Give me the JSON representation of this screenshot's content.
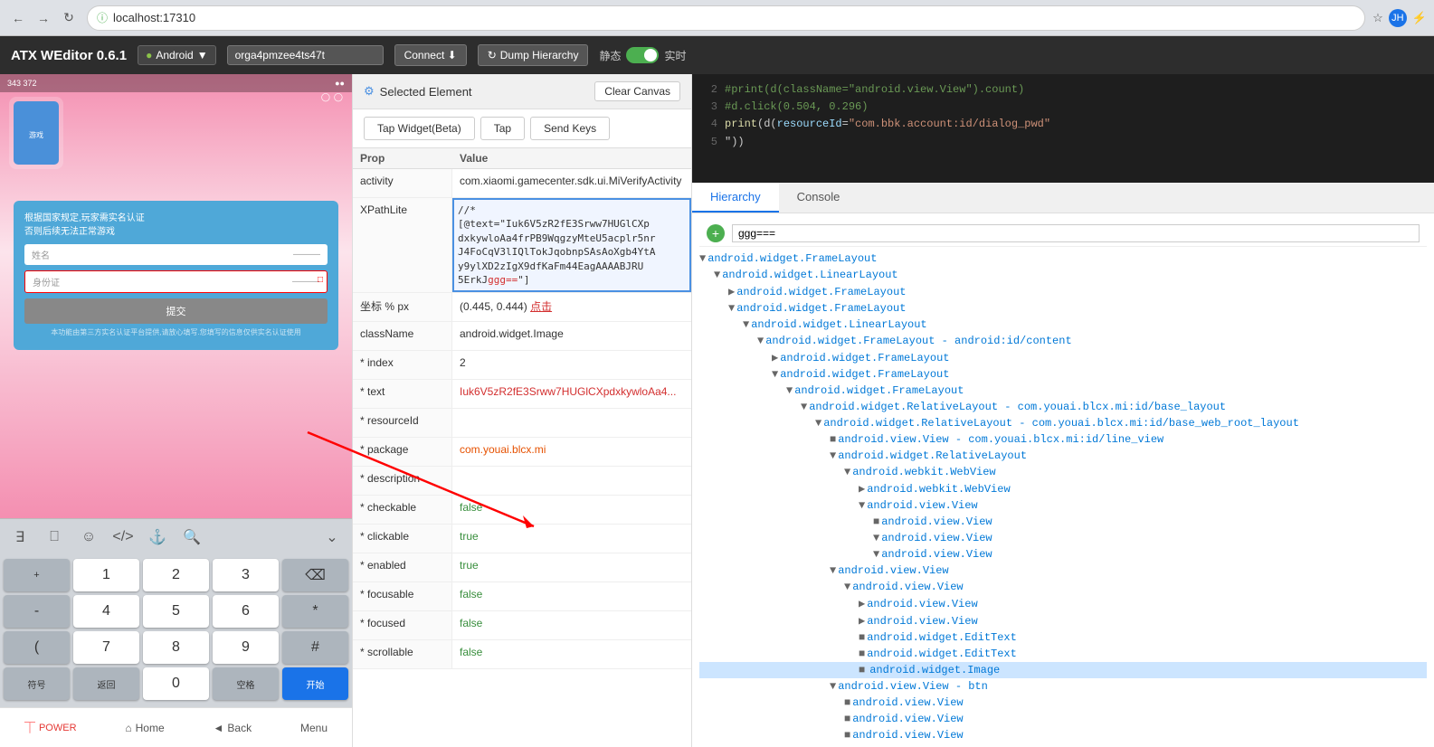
{
  "browser": {
    "url": "localhost:17310",
    "back_label": "←",
    "forward_label": "→",
    "refresh_label": "↻"
  },
  "app_header": {
    "title": "ATX WEditor 0.6.1",
    "android_label": "Android",
    "device_id": "orga4pmzee4ts47t",
    "connect_label": "Connect ⬇",
    "dump_label": "Dump Hierarchy",
    "static_label": "静态",
    "realtime_label": "实时"
  },
  "props_panel": {
    "selected_element_label": "Selected Element",
    "clear_canvas_label": "Clear Canvas",
    "tap_widget_label": "Tap Widget(Beta)",
    "tap_label": "Tap",
    "send_keys_label": "Send Keys",
    "header_prop": "Prop",
    "header_value": "Value",
    "rows": [
      {
        "name": "activity",
        "value": "com.xiaomi.gamecenter.sdk.ui.MiVerifyActivity",
        "style": "normal"
      },
      {
        "name": "XPathLite",
        "value": "//*[@text=\"Iuk6V5zR2fE3Srww7HUGlCXpdxkywloAa4frPB9WqgzyMteU5acplr5nrJ4FoCqV3lIQlTokJqobnpSAsAoXgb4YtAy9ylXD2zIgX9dfKaFm44EagAAAABJRU5ErkJggg==\"]",
        "style": "editable"
      },
      {
        "name": "坐标 % px",
        "value": "(0.445, 0.444) 点击",
        "style": "normal"
      },
      {
        "name": "className",
        "value": "android.widget.Image",
        "style": "normal"
      },
      {
        "name": "* index",
        "value": "2",
        "style": "normal"
      },
      {
        "name": "* text",
        "value": "Iuk6V5zR2fE3Srww7HUGlCXpdxkywloAa4...",
        "style": "red"
      },
      {
        "name": "* resourceId",
        "value": "",
        "style": "normal"
      },
      {
        "name": "* package",
        "value": "com.youai.blcx.mi",
        "style": "orange"
      },
      {
        "name": "* description",
        "value": "",
        "style": "normal"
      },
      {
        "name": "* checkable",
        "value": "false",
        "style": "green"
      },
      {
        "name": "* clickable",
        "value": "true",
        "style": "green"
      },
      {
        "name": "* enabled",
        "value": "true",
        "style": "green"
      },
      {
        "name": "* focusable",
        "value": "false",
        "style": "green"
      },
      {
        "name": "* focused",
        "value": "false",
        "style": "green"
      },
      {
        "name": "* scrollable",
        "value": "false",
        "style": "green"
      }
    ]
  },
  "code_panel": {
    "lines": [
      {
        "num": "2",
        "text": "#print(d(className=\"android.view.View\").count)"
      },
      {
        "num": "3",
        "text": "#d.click(0.504, 0.296)"
      },
      {
        "num": "4",
        "text": "print(d(resourceId=\"com.bbk.account:id/dialog_pwd\""
      },
      {
        "num": "5",
        "text": "\"))"
      }
    ]
  },
  "tabs": {
    "hierarchy_label": "Hierarchy",
    "console_label": "Console",
    "active": "hierarchy"
  },
  "hierarchy": {
    "search_placeholder": "ggg===",
    "nodes": [
      {
        "indent": 0,
        "text": "android.widget.FrameLayout"
      },
      {
        "indent": 1,
        "text": "android.widget.LinearLayout"
      },
      {
        "indent": 2,
        "text": "android.widget.FrameLayout"
      },
      {
        "indent": 2,
        "text": "android.widget.FrameLayout"
      },
      {
        "indent": 3,
        "text": "android.widget.LinearLayout"
      },
      {
        "indent": 4,
        "text": "android.widget.FrameLayout - android:id/content"
      },
      {
        "indent": 5,
        "text": "android.widget.FrameLayout"
      },
      {
        "indent": 5,
        "text": "android.widget.FrameLayout"
      },
      {
        "indent": 6,
        "text": "android.widget.FrameLayout"
      },
      {
        "indent": 7,
        "text": "android.widget.RelativeLayout - com.youai.blcx.mi:id/base_layout"
      },
      {
        "indent": 8,
        "text": "android.widget.RelativeLayout - com.youai.blcx.mi:id/base_web_root_layout"
      },
      {
        "indent": 9,
        "text": "android.view.View - com.youai.blcx.mi:id/line_view"
      },
      {
        "indent": 9,
        "text": "android.widget.RelativeLayout"
      },
      {
        "indent": 10,
        "text": "android.webkit.WebView"
      },
      {
        "indent": 11,
        "text": "android.webkit.WebView"
      },
      {
        "indent": 11,
        "text": "android.view.View"
      },
      {
        "indent": 12,
        "text": "android.view.View"
      },
      {
        "indent": 12,
        "text": "android.view.View"
      },
      {
        "indent": 12,
        "text": "android.view.View"
      },
      {
        "indent": 9,
        "text": "android.view.View"
      },
      {
        "indent": 10,
        "text": "android.view.View"
      },
      {
        "indent": 11,
        "text": "android.view.View"
      },
      {
        "indent": 11,
        "text": "android.view.View"
      },
      {
        "indent": 11,
        "text": "android.widget.EditText"
      },
      {
        "indent": 11,
        "text": "android.widget.EditText"
      },
      {
        "indent": 11,
        "text": "android.widget.Image",
        "selected": true
      },
      {
        "indent": 9,
        "text": "android.view.View - btn"
      },
      {
        "indent": 10,
        "text": "android.view.View"
      },
      {
        "indent": 10,
        "text": "android.view.View"
      },
      {
        "indent": 10,
        "text": "android.view.View"
      }
    ]
  },
  "phone": {
    "dialog_title": "根据国家规定,玩家需实名认证\n否则后续无法正常游戏",
    "field1_placeholder": "姓名",
    "field2_placeholder": "身份证",
    "submit_label": "提交",
    "bottom_notice": "本功能由第三方实名认证平台提供,请放心填写.您填写的信息仅供实名认证使用",
    "keyboard_keys": {
      "row1": [
        "+",
        "1",
        "2",
        "3",
        "⌫"
      ],
      "row2": [
        "-",
        "4",
        "5",
        "6",
        "*"
      ],
      "row3": [
        "(",
        "7",
        "8",
        "9",
        "#"
      ],
      "row4": [
        "符号",
        "返回",
        "0",
        "空格",
        "开始"
      ]
    },
    "bottom_nav": [
      "POWER",
      "Home",
      "Back",
      "Menu"
    ]
  }
}
